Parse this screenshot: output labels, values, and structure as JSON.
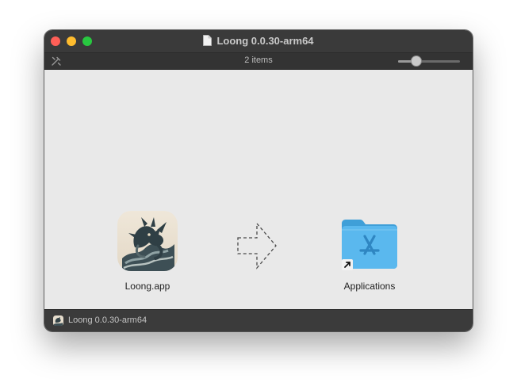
{
  "window": {
    "title": "Loong 0.0.30-arm64"
  },
  "toolbar": {
    "item_count": "2 items",
    "icon_size_slider": 0.3
  },
  "items": [
    {
      "label": "Loong.app",
      "icon": "dragon-app-icon"
    },
    {
      "label": "Applications",
      "icon": "applications-folder-alias-icon"
    }
  ],
  "statusbar": {
    "path_label": "Loong 0.0.30-arm64"
  },
  "colors": {
    "close": "#ff5f57",
    "minimize": "#febc2e",
    "zoom": "#28c840",
    "folder": "#4fb3ea"
  }
}
